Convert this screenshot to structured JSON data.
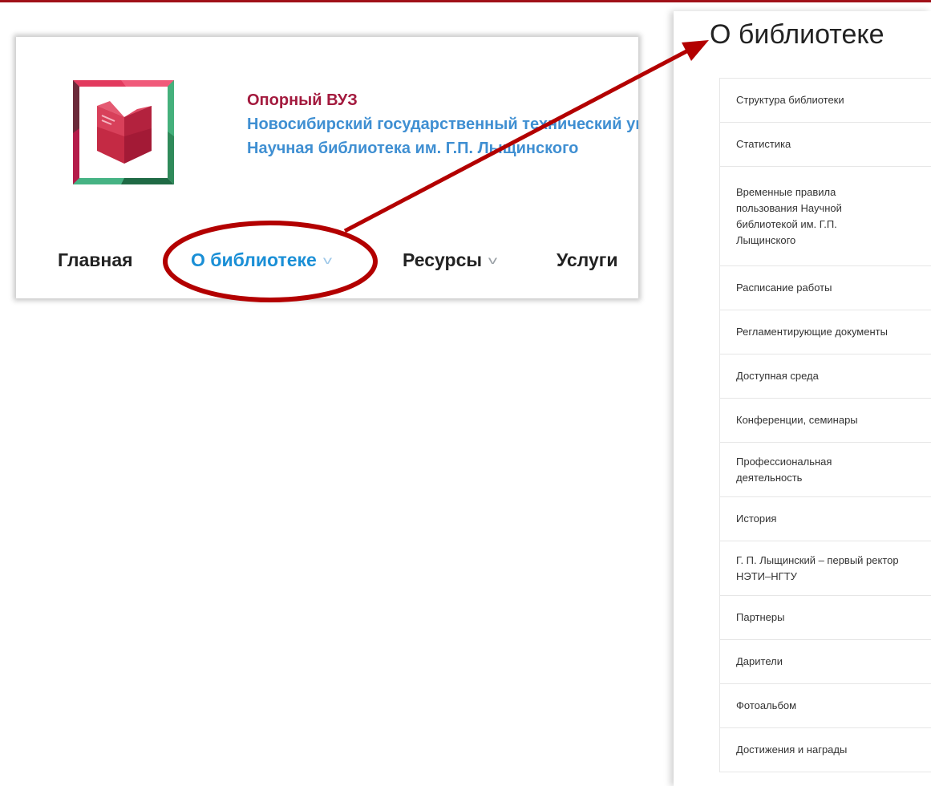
{
  "header": {
    "brand_lines": [
      "Опорный ВУЗ",
      "Новосибирский государственный технический университет",
      "Научная библиотека им. Г.П. Лыщинского"
    ]
  },
  "nav": {
    "items": [
      {
        "label": "Главная"
      },
      {
        "label": "О библиотеке",
        "active": true
      },
      {
        "label": "Ресурсы"
      },
      {
        "label": "Услуги"
      }
    ]
  },
  "panel": {
    "title": "О библиотеке",
    "items": [
      "Структура библиотеки",
      "Статистика",
      "Временные правила пользования Научной библиотекой им. Г.П. Лыщинского",
      "Расписание работы",
      "Регламентирующие документы",
      "Доступная среда",
      "Конференции, семинары",
      "Профессиональная деятельность",
      "История",
      "Г. П. Лыщинский – первый ректор НЭТИ–НГТУ",
      "Партнеры",
      "Дарители",
      "Фотоальбом",
      "Достижения и награды"
    ]
  },
  "colors": {
    "accent_red": "#a31a3e",
    "link_blue": "#3f8fd2",
    "active_nav": "#1a8fd6",
    "annotation": "#b30000"
  }
}
